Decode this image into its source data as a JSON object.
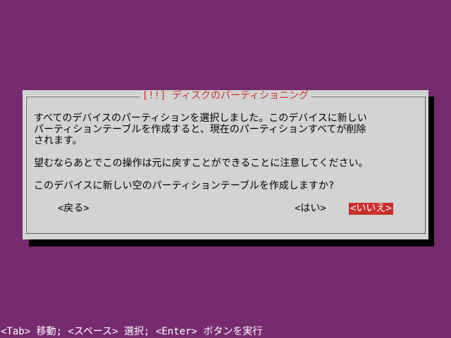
{
  "dialog": {
    "title": "[!!] ディスクのパーティショニング",
    "message_lines": [
      "すべてのデバイスのパーティションを選択しました。このデバイスに新しい",
      "パーティションテーブルを作成すると、現在のパーティションすべてが削除",
      "されます。"
    ],
    "warning": "望むならあとでこの操作は元に戻すことができることに注意してください。",
    "question": "このデバイスに新しい空のパーティションテーブルを作成しますか?",
    "buttons": {
      "back": "<戻る>",
      "yes": "<はい>",
      "no": "<いいえ>"
    },
    "selected_button": "no"
  },
  "footer": {
    "help_text": "<Tab> 移動; <スペース> 選択; <Enter> ボタンを実行"
  },
  "colors": {
    "background": "#772b6f",
    "dialog": "#d3d3d3",
    "accent": "#c7312b"
  }
}
